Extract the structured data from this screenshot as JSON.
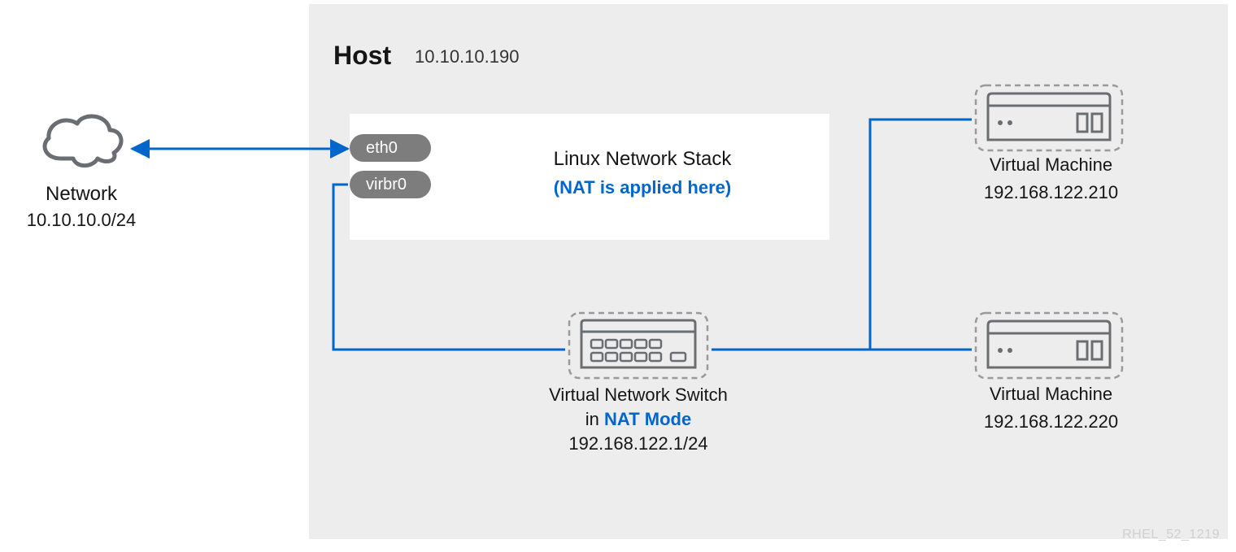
{
  "host": {
    "title": "Host",
    "ip": "10.10.10.190",
    "stack": {
      "title": "Linux Network Stack",
      "note": "(NAT is applied here)",
      "interfaces": {
        "eth0": "eth0",
        "virbr0": "virbr0"
      }
    },
    "switch": {
      "label": "Virtual Network Switch",
      "mode_prefix": "in ",
      "mode": "NAT Mode",
      "ip": "192.168.122.1/24"
    },
    "vms": [
      {
        "label": "Virtual Machine",
        "ip": "192.168.122.210"
      },
      {
        "label": "Virtual Machine",
        "ip": "192.168.122.220"
      }
    ]
  },
  "network": {
    "label": "Network",
    "subnet": "10.10.10.0/24"
  },
  "watermark": "RHEL_52_1219",
  "colors": {
    "accent": "#0066cc",
    "icon": "#6a6e73"
  }
}
